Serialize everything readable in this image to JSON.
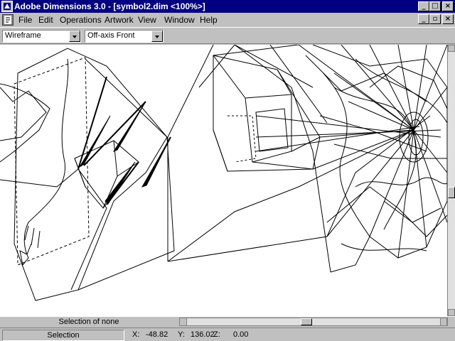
{
  "window": {
    "title": "Adobe Dimensions 3.0 - [symbol2.dim <100%>]",
    "minimize": "_",
    "maximize": "□",
    "close": "×"
  },
  "menu": {
    "items": [
      {
        "label": "File"
      },
      {
        "label": "Edit"
      },
      {
        "label": "Operations"
      },
      {
        "label": "Artwork"
      },
      {
        "label": "View"
      },
      {
        "label": "Window"
      },
      {
        "label": "Help"
      }
    ],
    "doc_minimize": "_",
    "doc_restore": "▫",
    "doc_close": "×"
  },
  "toolbar": {
    "render_mode": "Wireframe",
    "view_mode": "Off-axis Front"
  },
  "selection_info": "Selection of none",
  "status": {
    "tool": "Selection",
    "x_label": "X:",
    "x_value": "-48.82",
    "y_label": "Y:",
    "y_value": "136.02",
    "z_label": "Z:",
    "z_value": "0.00"
  },
  "icons": {
    "app": "dimensions-app-icon",
    "doc": "document-icon"
  }
}
